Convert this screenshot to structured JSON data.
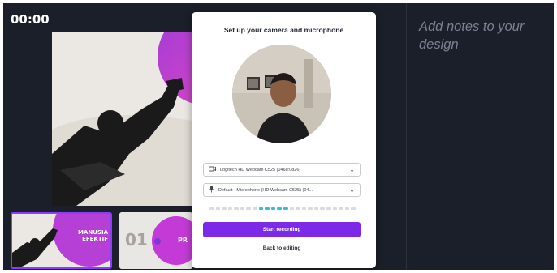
{
  "editor": {
    "timer": "00:00",
    "notes_placeholder": "Add notes to your design"
  },
  "thumbnails": [
    {
      "lines": [
        "MANUSIA",
        "EFEKTIF"
      ]
    },
    {
      "number": "01",
      "text": "PR"
    }
  ],
  "modal": {
    "title": "Set up your camera and microphone",
    "camera_select": {
      "icon": "video-camera-icon",
      "value": "Logitech HD Webcam C525 (046d:0826)"
    },
    "mic_select": {
      "icon": "microphone-icon",
      "value": "Default - Microphone (HD Webcam C525) (04..."
    },
    "mic_level": 0.4,
    "start_button": "Start recording",
    "back_link": "Back to editing"
  },
  "colors": {
    "accent": "#7d2ae8",
    "meter_active": "#2ec4d4",
    "editor_bg": "#1b1f2a",
    "slide_magenta": "#c43ad6"
  }
}
